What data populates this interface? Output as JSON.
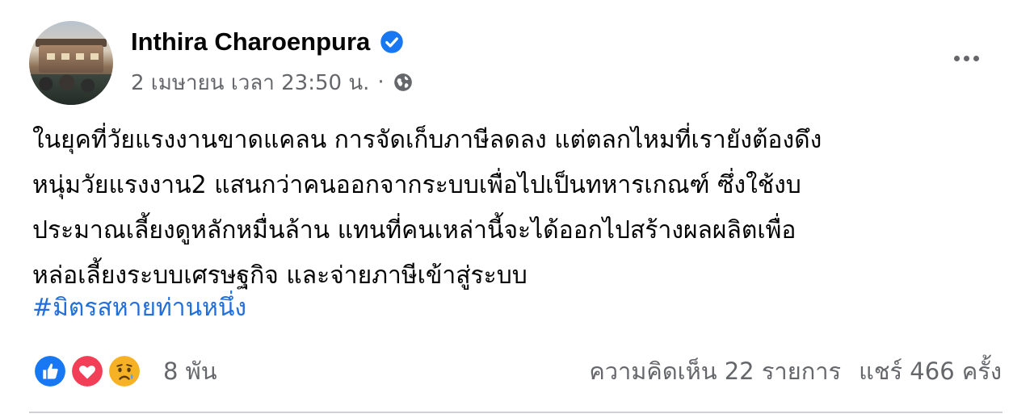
{
  "post": {
    "author_name": "Inthira Charoenpura",
    "timestamp": "2 เมษายน เวลา 23:50 น.",
    "separator": "·",
    "privacy_icon": "globe-icon",
    "verified_icon": "verified-badge-icon",
    "more_icon": "more-options-icon",
    "body_lines": [
      "ในยุคที่วัยแรงงานขาดแคลน การจัดเก็บภาษีลดลง แต่ตลกไหมที่เรายังต้องดึง",
      "หนุ่มวัยแรงงาน2 แสนกว่าคนออกจากระบบเพื่อไปเป็นทหารเกณฑ์ ซึ่งใช้งบ",
      "ประมาณเลี้ยงดูหลักหมื่นล้าน แทนที่คนเหล่านี้จะได้ออกไปสร้างผลผลิตเพื่อ",
      "หล่อเลี้ยงระบบเศรษฐกิจ และจ่ายภาษีเข้าสู่ระบบ"
    ],
    "hashtag": "#มิตรสหายท่านหนึ่ง"
  },
  "engagement": {
    "reaction_icons": [
      "like-reaction-icon",
      "love-reaction-icon",
      "sad-reaction-icon"
    ],
    "reaction_count": "8 พัน",
    "comments": "ความคิดเห็น 22 รายการ",
    "shares": "แชร์ 466 ครั้ง"
  },
  "colors": {
    "link": "#216fdb",
    "secondary_text": "#65676b",
    "verified": "#1877f2",
    "like": "#1877f2",
    "love": "#f33e58",
    "sad": "#f7b125"
  }
}
